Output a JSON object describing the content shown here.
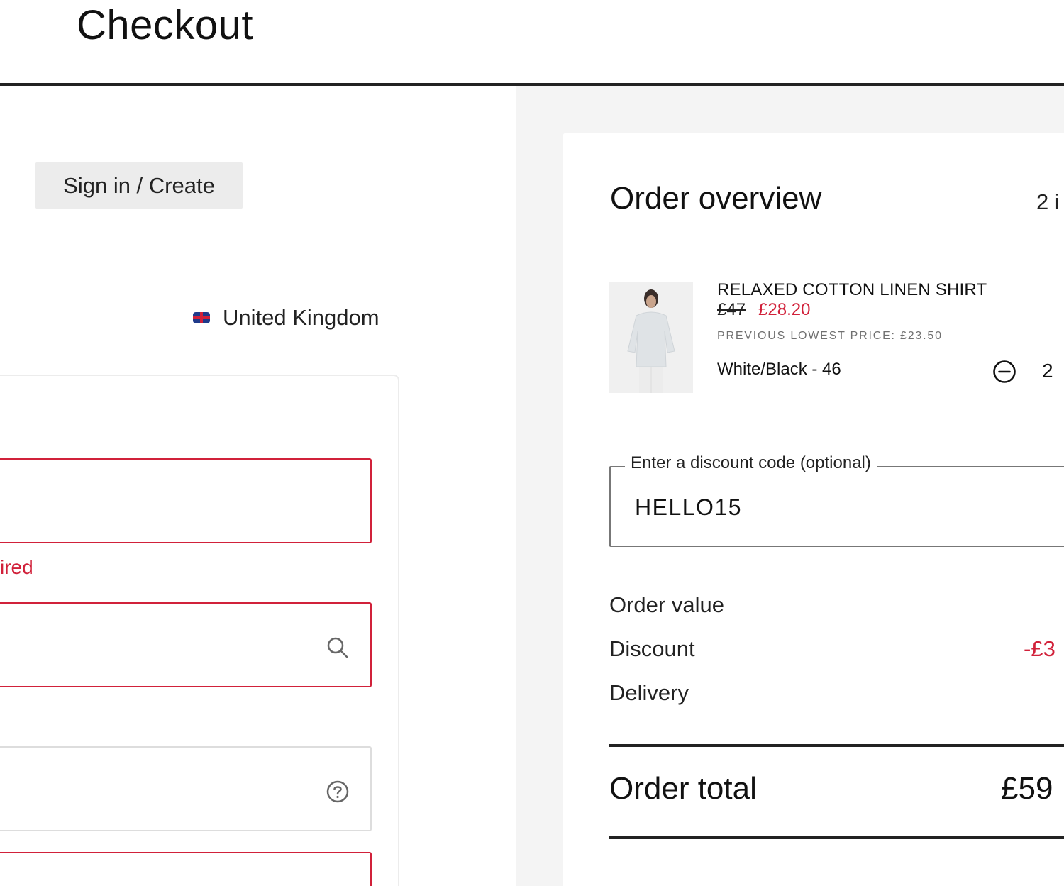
{
  "header": {
    "title": "Checkout"
  },
  "account": {
    "signin_label": "Sign in / Create"
  },
  "country": {
    "name": "United Kingdom",
    "flag_icon": "uk-flag-icon"
  },
  "form": {
    "error_text": "ired",
    "search_icon": "search-icon",
    "help_icon": "help-circle-icon",
    "error_color": "#d1213a"
  },
  "summary": {
    "title": "Order overview",
    "item_count": "2 i",
    "product": {
      "name": "RELAXED COTTON LINEN SHIRT",
      "old_price": "£47",
      "new_price": "£28.20",
      "lowest_price": "PREVIOUS LOWEST PRICE: £23.50",
      "variant": "White/Black - 46",
      "quantity": "2",
      "minus_icon": "minus-circle-icon"
    },
    "discount": {
      "legend": "Enter a discount code (optional)",
      "value": "HELLO15"
    },
    "rows": [
      {
        "label": "Order value",
        "value": ""
      },
      {
        "label": "Discount",
        "value": "-£3"
      },
      {
        "label": "Delivery",
        "value": ""
      }
    ],
    "total": {
      "label": "Order total",
      "value": "£59"
    }
  }
}
